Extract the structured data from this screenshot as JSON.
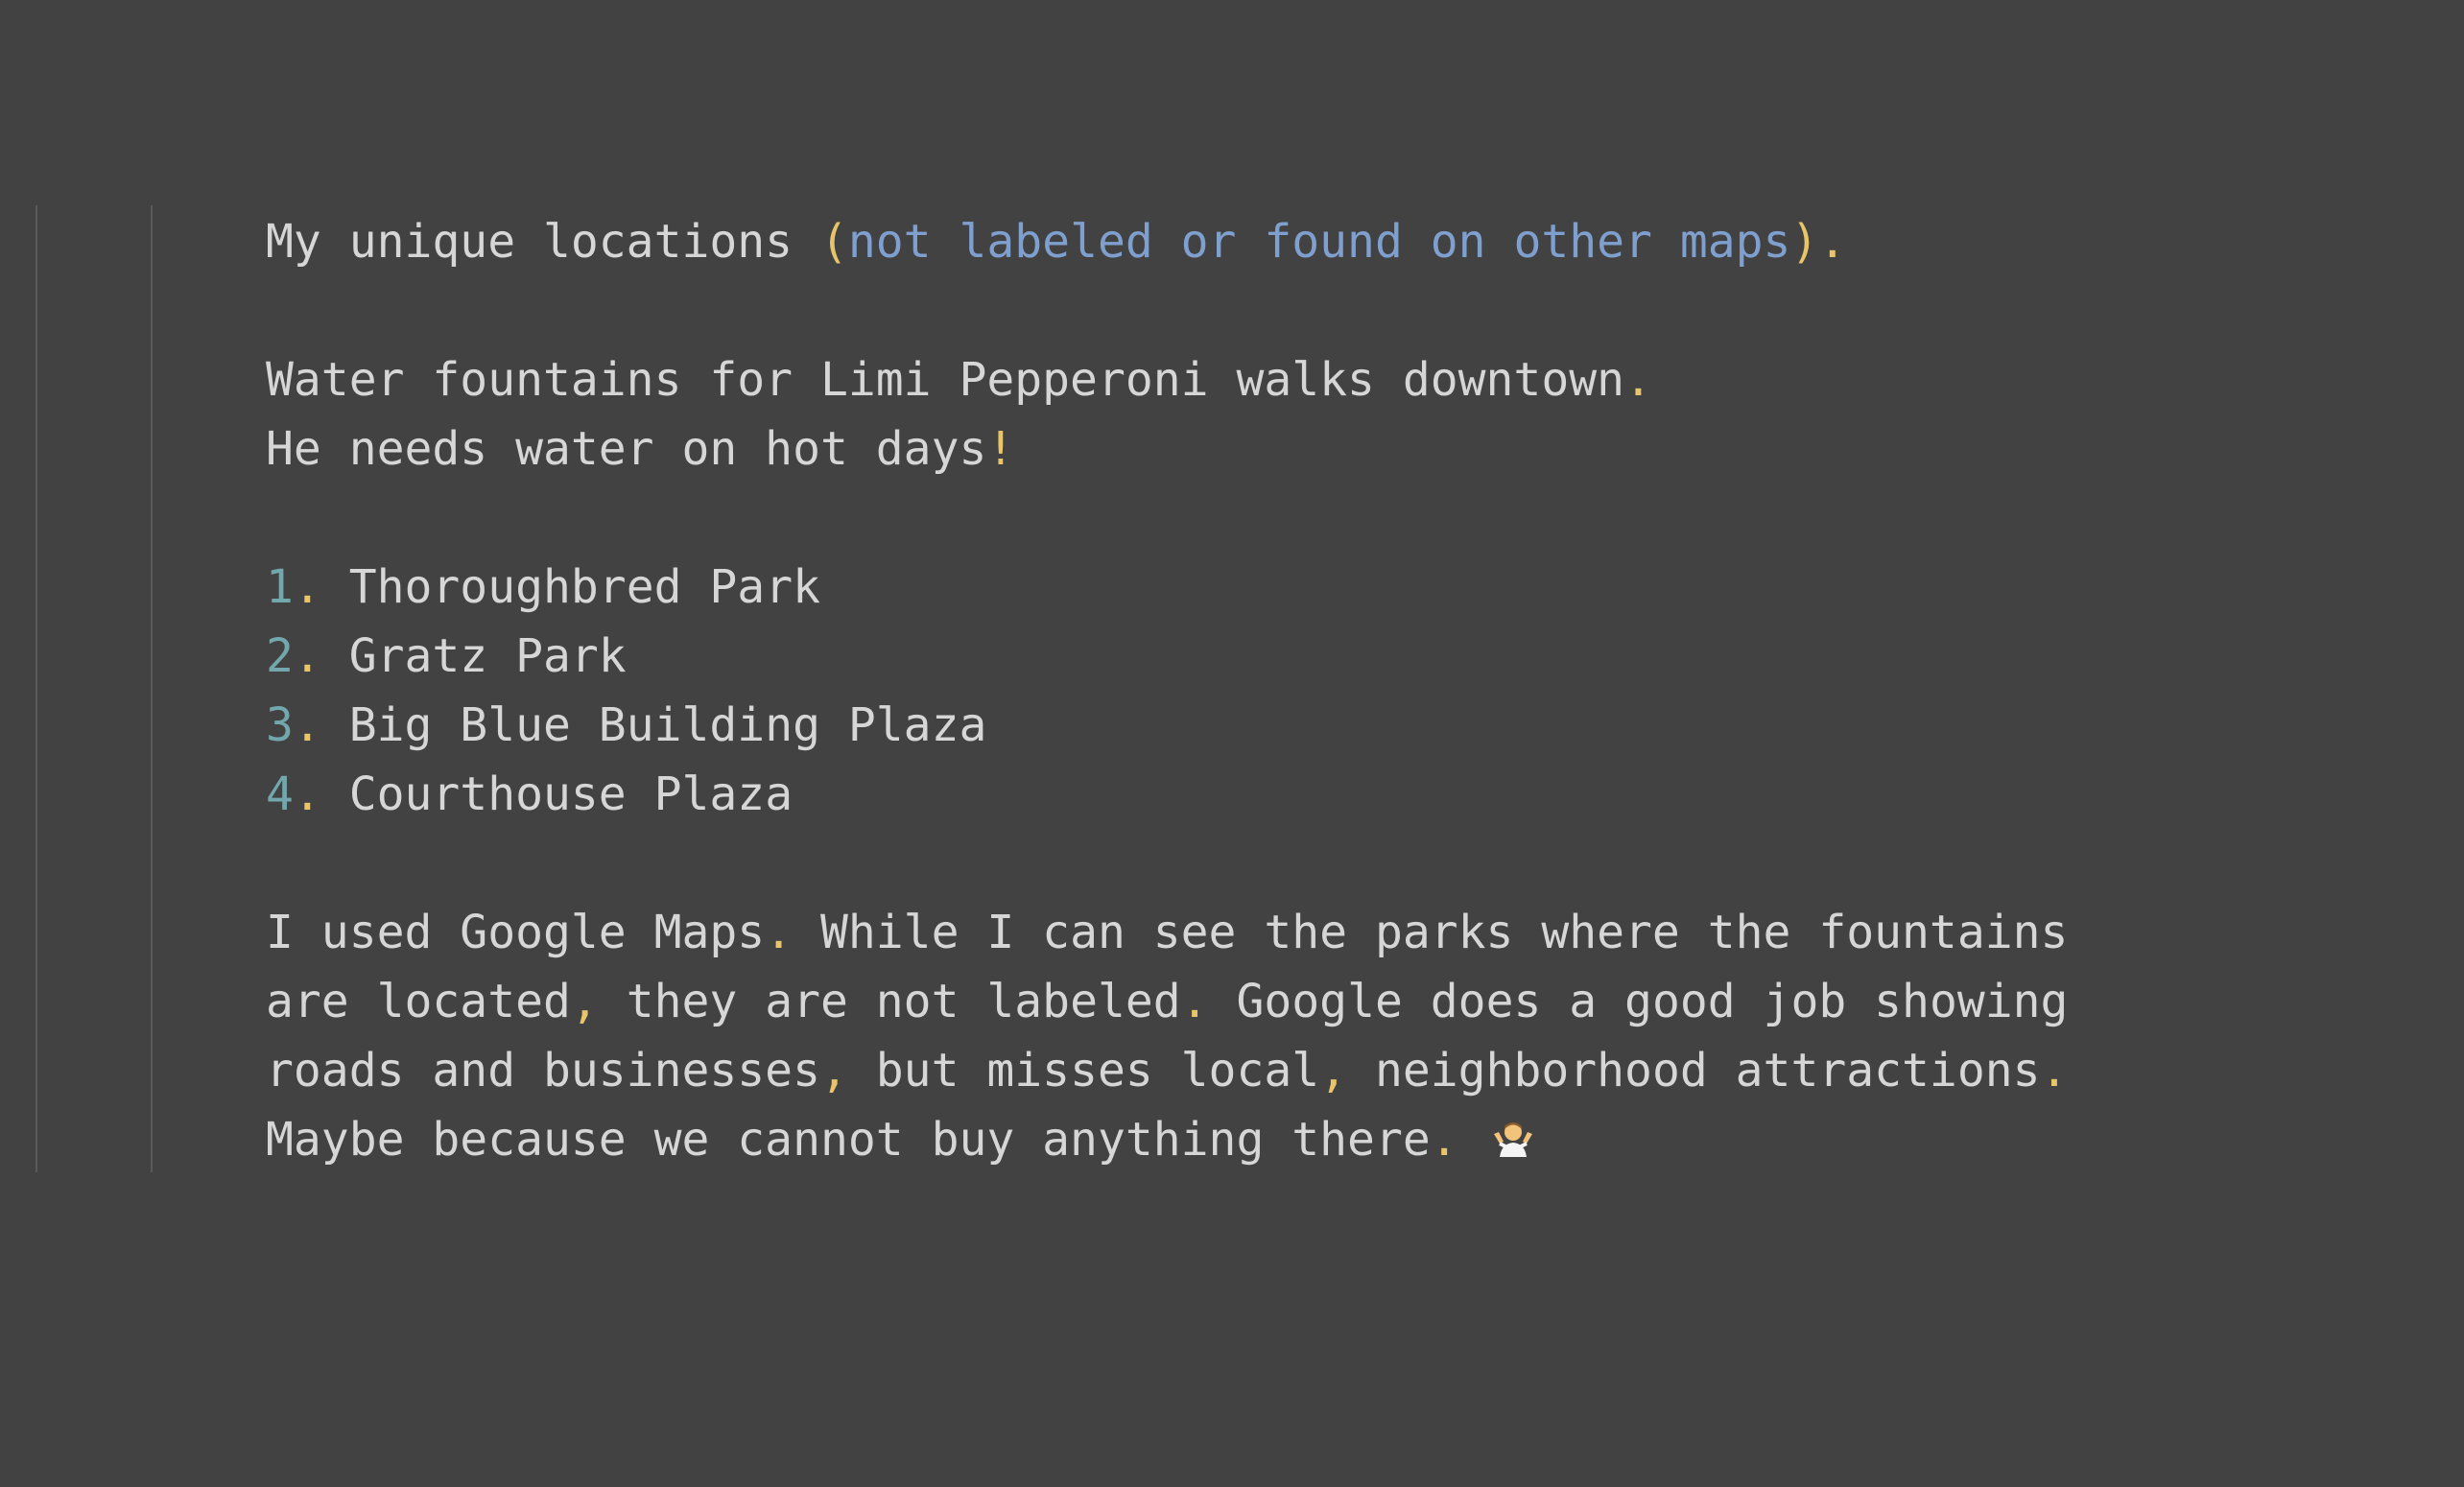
{
  "colors": {
    "background": "#424242",
    "text": "#d6d6d6",
    "punctuation": "#e8c46a",
    "link": "#7f9fcf",
    "list_number": "#72a8ad"
  },
  "heading": {
    "lead": "My unique locations ",
    "open_paren": "(",
    "link": "not labeled or found on other maps",
    "close_paren": ")",
    "period": "."
  },
  "intro": {
    "line1_text": "Water fountains for Limi Pepperoni walks downtown",
    "line1_punct": ".",
    "line2_text": "He needs water on hot days",
    "line2_punct": "!"
  },
  "list": [
    {
      "number": "1",
      "dot": ".",
      "label": " Thoroughbred Park"
    },
    {
      "number": "2",
      "dot": ".",
      "label": " Gratz Park"
    },
    {
      "number": "3",
      "dot": ".",
      "label": " Big Blue Building Plaza"
    },
    {
      "number": "4",
      "dot": ".",
      "label": " Courthouse Plaza"
    }
  ],
  "closing": {
    "l1_a": "I used Google Maps",
    "l1_p": ".",
    "l1_b": " While I can see the parks where the fountains",
    "l2_a": "are located",
    "l2_p1": ",",
    "l2_b": " they are not labeled",
    "l2_p2": ".",
    "l2_c": " Google does a good job showing",
    "l3_a": "roads and businesses",
    "l3_p1": ",",
    "l3_b": " but misses local",
    "l3_p2": ",",
    "l3_c": " neighborhood attractions",
    "l3_p3": ".",
    "l4_a": "Maybe because we cannot buy anything there",
    "l4_p": ".",
    "emoji_icon": "person-shrugging-icon"
  }
}
